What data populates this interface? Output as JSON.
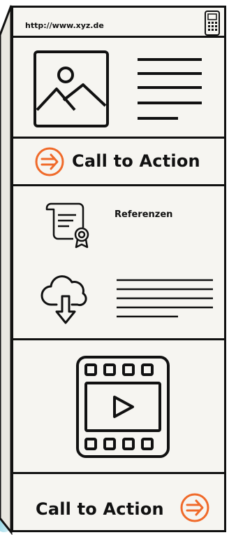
{
  "header": {
    "url": "http://www.xyz.de",
    "phone_icon": "phone-icon"
  },
  "hero": {
    "image_icon": "image-placeholder-icon",
    "text_icon": "text-lines-icon"
  },
  "cta_top": {
    "label": "Call to Action",
    "icon": "arrow-circle-icon"
  },
  "references": {
    "label": "Referenzen",
    "certificate_icon": "certificate-icon",
    "download_icon": "cloud-download-icon"
  },
  "video": {
    "icon": "video-play-icon"
  },
  "cta_bottom": {
    "label": "Call to Action",
    "icon": "arrow-circle-icon"
  },
  "colors": {
    "accent": "#f06a2a",
    "teal": "#1aa7c9",
    "ink": "#111111",
    "panel": "#f6f5f1"
  }
}
